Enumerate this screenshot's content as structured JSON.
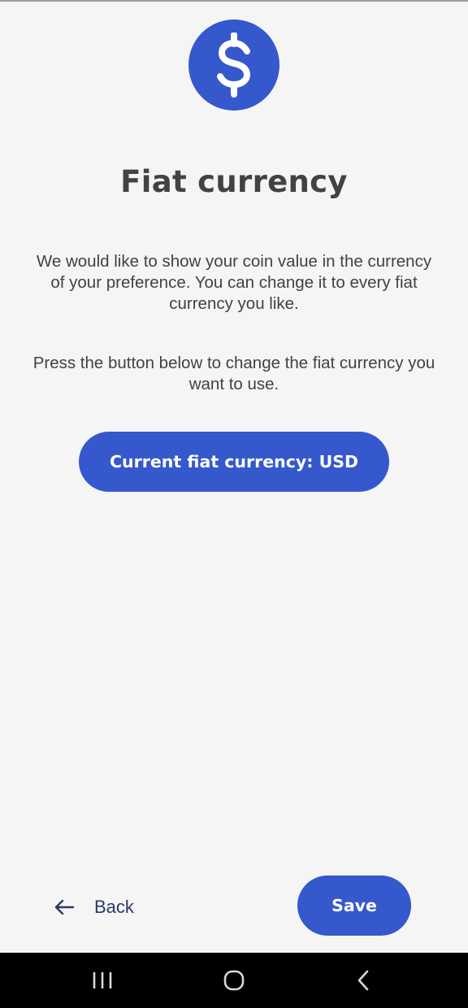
{
  "page": {
    "title": "Fiat currency",
    "description_1": "We would like to show your coin value in the currency of your preference. You can change it to every fiat currency you like.",
    "description_2": "Press the button below to change the fiat currency you want to use."
  },
  "currency_button": {
    "label": "Current fiat currency: USD"
  },
  "footer": {
    "back_label": "Back",
    "save_label": "Save"
  },
  "icons": {
    "header": "dollar-sign-icon",
    "back": "arrow-left-icon",
    "nav_recent": "recent-apps-icon",
    "nav_home": "home-icon",
    "nav_back": "chevron-left-icon"
  },
  "colors": {
    "accent": "#3558cc",
    "background": "#f5f5f5",
    "text": "#424242",
    "back_text": "#2a3a66",
    "nav_bar": "#000000"
  }
}
